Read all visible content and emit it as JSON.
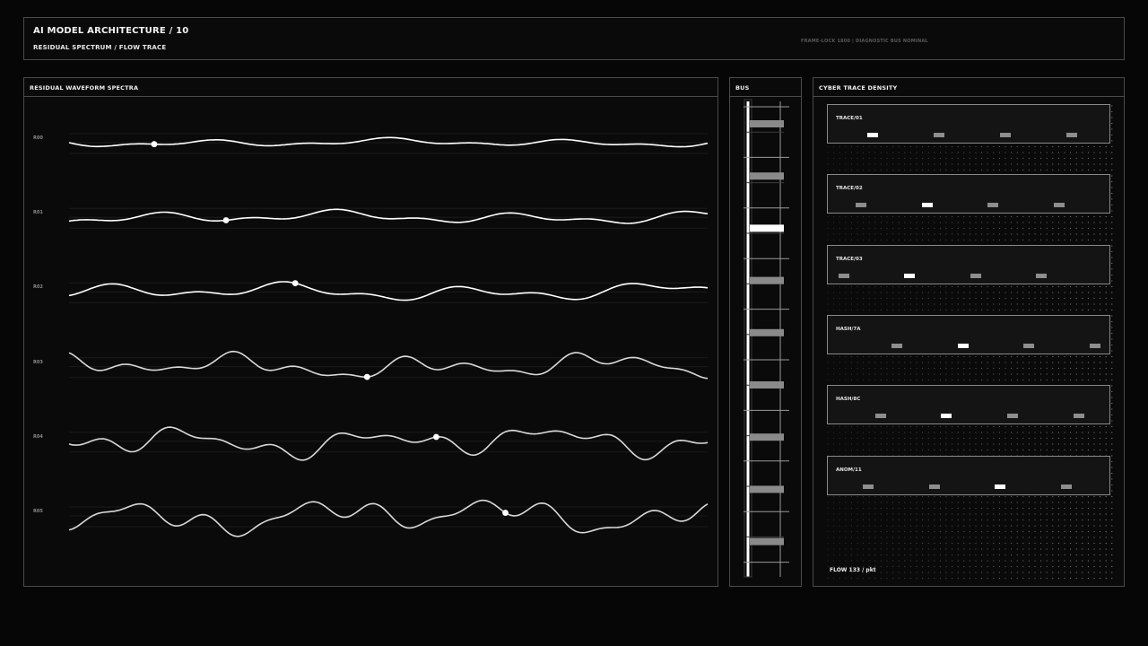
{
  "header": {
    "title": "AI MODEL ARCHITECTURE / 10",
    "subtitle": "RESIDUAL SPECTRUM / FLOW TRACE",
    "status": "FRAME-LOCK 1800 | DIAGNOSTIC BUS NOMINAL"
  },
  "spectra": {
    "title": "RESIDUAL WAVEFORM SPECTRA",
    "rows": [
      {
        "label": "R00",
        "marker": 0.135
      },
      {
        "label": "R01",
        "marker": 0.245
      },
      {
        "label": "R02",
        "marker": 0.355
      },
      {
        "label": "R03",
        "marker": 0.465
      },
      {
        "label": "R04",
        "marker": 0.575
      },
      {
        "label": "R05",
        "marker": 0.685
      }
    ]
  },
  "bus": {
    "title": "BUS",
    "blocks": 9,
    "active_block": 2
  },
  "density": {
    "title": "CYBER TRACE DENSITY",
    "cards": [
      {
        "label": "TRACE/01",
        "active": 0
      },
      {
        "label": "TRACE/02",
        "active": 1
      },
      {
        "label": "TRACE/03",
        "active": 1
      },
      {
        "label": "HASH/7A",
        "active": 1
      },
      {
        "label": "HASH/8C",
        "active": 1
      },
      {
        "label": "ANOM/11",
        "active": 2
      }
    ],
    "footer": "FLOW 133 / pkt"
  },
  "colors": {
    "background": "#060606",
    "panel_border": "#4a4a4a",
    "wave": "#ffffff",
    "marker_inactive": "#8e8e8e",
    "marker_active": "#ffffff"
  }
}
